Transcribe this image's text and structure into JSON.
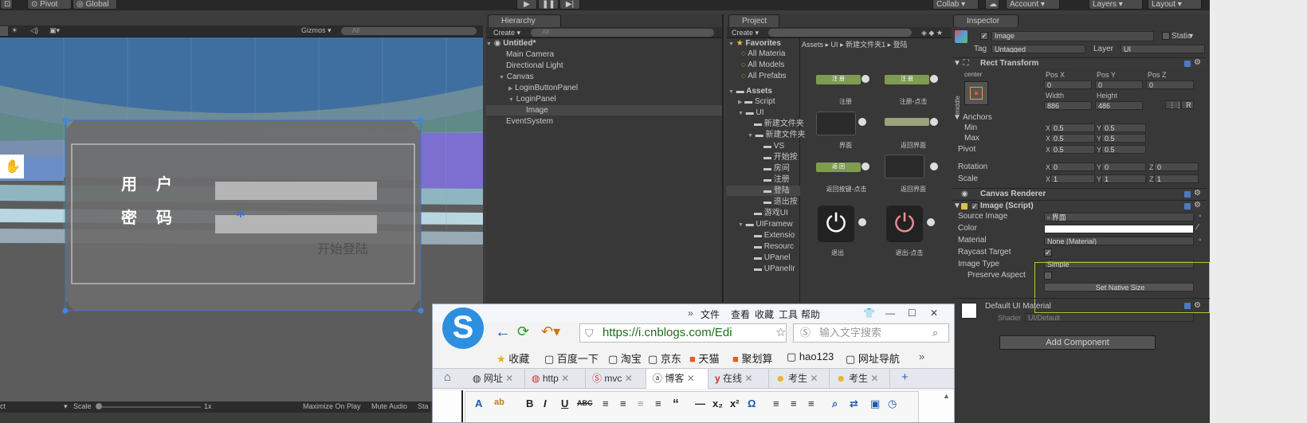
{
  "toolbar": {
    "pivot": "Pivot",
    "global": "Global",
    "collab": "Collab ▾",
    "account": "Account",
    "layers": "Layers",
    "layout": "Layout"
  },
  "scene": {
    "gizmos": "Gizmos",
    "search_placeholder": "All",
    "label_user": "用　户",
    "label_password": "密　码",
    "start_login": "开始登陆",
    "bottom_scale": "Scale",
    "bottom_scale_value": "1x",
    "bottom_left": "ct",
    "bottom_maximize": "Maximize On Play",
    "bottom_mute": "Mute Audio",
    "bottom_stats": "Sta"
  },
  "hierarchy": {
    "tab": "Hierarchy",
    "create": "Create",
    "search_placeholder": "All",
    "scene_name": "Untitled*",
    "items": [
      "Main Camera",
      "Directional Light",
      "Canvas",
      "LoginButtonPanel",
      "LoginPanel",
      "Image",
      "EventSystem"
    ]
  },
  "project": {
    "tab": "Project",
    "create": "Create",
    "favorites": "Favorites",
    "fav_items": [
      "All Materia",
      "All Models",
      "All Prefabs"
    ],
    "assets": "Assets",
    "tree": [
      "Script",
      "UI",
      "新建文件夹",
      "新建文件夹",
      "VS",
      "开始按",
      "房间",
      "注册",
      "登陆",
      "退出按",
      "游戏UI",
      "UIFramew",
      "Extensio",
      "Resourc",
      "UPanel",
      "UPanelIr"
    ],
    "breadcrumb": [
      "Assets",
      "UI",
      "新建文件夹1",
      "登陆"
    ],
    "grid_labels": [
      "注册",
      "注册-点击",
      "界面",
      "返回界面",
      "返回按键-点击",
      "返回界面",
      "退出",
      "退出-点击"
    ],
    "btn_label_reg": "注 册",
    "btn_label_back": "返 回"
  },
  "inspector": {
    "tab": "Inspector",
    "name": "Image",
    "static": "Static",
    "tag_label": "Tag",
    "tag_value": "Untagged",
    "layer_label": "Layer",
    "layer_value": "UI",
    "rect_transform": "Rect Transform",
    "center": "center",
    "middle": "middle",
    "pos_x_label": "Pos X",
    "pos_y_label": "Pos Y",
    "pos_z_label": "Pos Z",
    "pos_x": "0",
    "pos_y": "0",
    "pos_z": "0",
    "width_label": "Width",
    "height_label": "Height",
    "width": "886",
    "height": "486",
    "r_btn": "R",
    "anchors": "Anchors",
    "min": "Min",
    "max": "Max",
    "pivot": "Pivot",
    "min_x": "0.5",
    "min_y": "0.5",
    "max_x": "0.5",
    "max_y": "0.5",
    "pivot_x": "0.5",
    "pivot_y": "0.5",
    "rotation": "Rotation",
    "scale": "Scale",
    "rot_x": "0",
    "rot_y": "0",
    "rot_z": "0",
    "scale_x": "1",
    "scale_y": "1",
    "scale_z": "1",
    "x": "X",
    "y": "Y",
    "z": "Z",
    "canvas_renderer": "Canvas Renderer",
    "image_script": "Image (Script)",
    "source_image_label": "Source Image",
    "source_image": "界面",
    "color_label": "Color",
    "material_label": "Material",
    "material": "None (Material)",
    "raycast_label": "Raycast Target",
    "image_type_label": "Image Type",
    "image_type": "Simple",
    "preserve_label": "Preserve Aspect",
    "set_native": "Set Native Size",
    "default_material": "Default UI Material",
    "shader_label": "Shader",
    "shader": "UI/Default",
    "add_component": "Add Component"
  },
  "browser": {
    "menu": [
      "文件",
      "查看",
      "收藏",
      "工具",
      "帮助"
    ],
    "url": "https://i.cnblogs.com/Edi",
    "search_placeholder": "输入文字搜索",
    "favorites": [
      "收藏",
      "百度一下",
      "淘宝",
      "京东",
      "天猫",
      "聚划算",
      "hao123",
      "网址导航"
    ],
    "tabs": [
      "网址",
      "http",
      "mvc",
      "博客",
      "在线",
      "考生",
      "考生"
    ],
    "editor_buttons": [
      "A",
      "ab",
      "B",
      "I",
      "U",
      "ABC",
      "≡",
      "≡",
      "≡",
      "≡",
      "“",
      "—",
      "x₂",
      "x²",
      "Ω",
      "≡",
      "≡",
      "≡"
    ]
  },
  "colors": {
    "unity_bg": "#383838",
    "accent_green": "#b4c832",
    "url_green": "#1c6f1c"
  }
}
